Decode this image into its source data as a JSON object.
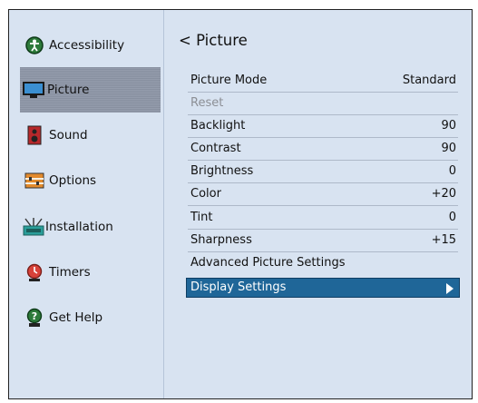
{
  "sidebar": {
    "items": [
      {
        "label": "Accessibility",
        "icon": "accessibility-icon"
      },
      {
        "label": "Picture",
        "icon": "picture-icon"
      },
      {
        "label": "Sound",
        "icon": "speaker-icon"
      },
      {
        "label": "Options",
        "icon": "options-icon"
      },
      {
        "label": "Installation",
        "icon": "antenna-icon"
      },
      {
        "label": "Timers",
        "icon": "timer-icon"
      },
      {
        "label": "Get Help",
        "icon": "help-icon"
      }
    ],
    "selected": "Picture"
  },
  "main": {
    "back_glyph": "<",
    "title": "Picture",
    "rows": [
      {
        "label": "Picture Mode",
        "value": "Standard"
      },
      {
        "label": "Reset",
        "value": ""
      },
      {
        "label": "Backlight",
        "value": "90"
      },
      {
        "label": "Contrast",
        "value": "90"
      },
      {
        "label": "Brightness",
        "value": "0"
      },
      {
        "label": "Color",
        "value": "+20"
      },
      {
        "label": "Tint",
        "value": "0"
      },
      {
        "label": "Sharpness",
        "value": "+15"
      },
      {
        "label": "Advanced Picture Settings",
        "value": ""
      },
      {
        "label": "Display Settings",
        "value": ""
      }
    ],
    "selected_row": "Display Settings"
  },
  "colors": {
    "background": "#d8e3f1",
    "sidebar_selected": "#8d96a7",
    "row_selected": "#1f6698"
  }
}
